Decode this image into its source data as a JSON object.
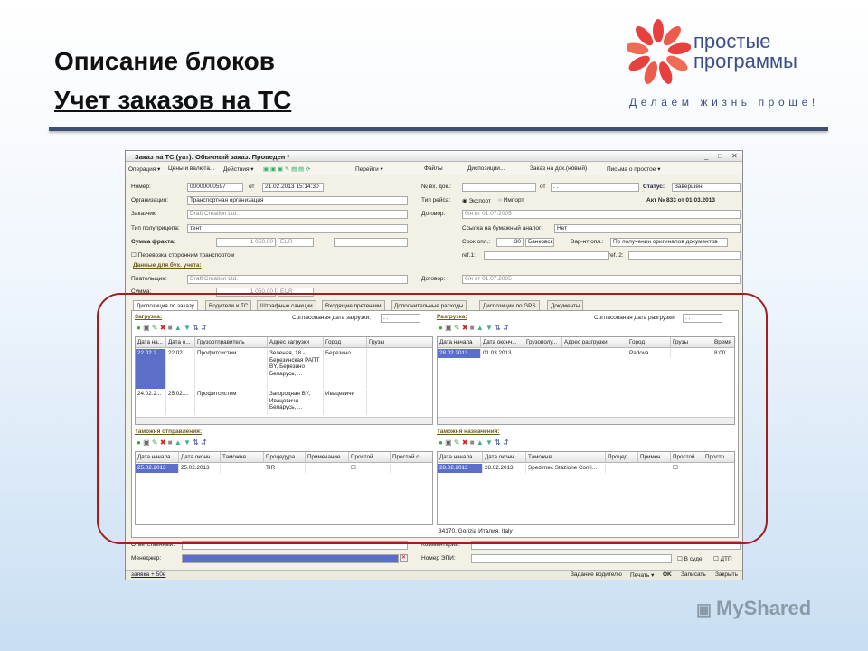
{
  "slide": {
    "title": "Описание блоков",
    "subtitle": "Учет заказов на ТС",
    "logo_name_1": "простые",
    "logo_name_2": "программы",
    "logo_slogan": "Делаем жизнь проще!",
    "watermark": "MyShared",
    "colors": {
      "accent": "#3d4f8a",
      "oval": "#a02020",
      "selection": "#5b6fc9"
    }
  },
  "window": {
    "title": "Заказ на ТС (уат): Обычный заказ. Проведен *",
    "toolbar": [
      "Операция ▾",
      "Цены и валюта...",
      "Действия ▾",
      "Перейти ▾",
      "Файлы",
      "Диспозиции...",
      "Заказ на док.(новый)",
      "Письма о простое ▾"
    ],
    "form": {
      "number_label": "Номер:",
      "number": "00000000597",
      "from_label": "от",
      "date": "21.02.2013 15:14:30",
      "inc_label": "№ вх. док.:",
      "inc_from": "от",
      "inc_date": ". .",
      "status_label": "Статус:",
      "status": "Завершен",
      "org_label": "Организация:",
      "org": "Транспортная организация",
      "trip_label": "Тип рейса:",
      "export": "Экспорт",
      "import": "Импорт",
      "act": "Акт № 833 от 01.03.2013",
      "customer_label": "Заказчик:",
      "customer": "Draft Creation Ltd.",
      "contract_label": "Договор:",
      "contract": "б/н от 01.07.2005",
      "trailer_label": "Тип полуприцепа:",
      "trailer": "тент",
      "paper_label": "Ссылка на бумажный аналог:",
      "paper": "Нет",
      "freight_label": "Сумма фрахта:",
      "freight": "1 050,00",
      "currency": "EUR",
      "term_label": "Срок опл.:",
      "term": "30",
      "bank": "Банковск",
      "variant_label": "Вар-нт опл.:",
      "variant": "По получении оригиналов документов",
      "third_party": "Перевозка сторонним транспортом",
      "ref1": "ref.1:",
      "ref2": "ref. 2:",
      "acc_header": "Данные для бух. учета:",
      "payer_label": "Плательщик:",
      "payer": "Draft Creation Ltd.",
      "contract2_label": "Договор:",
      "contract2": "б/н от 01.07.2005",
      "sum_label": "Сумма:",
      "sum": "1 050,00",
      "sum_cur": "EUR"
    },
    "tabs": [
      "Диспозиция по заказу",
      "Водители и ТС",
      "Штрафные санкции",
      "Входящие претензии",
      "Дополнительные расходы",
      "Диспозиции по GPS",
      "Документы"
    ],
    "loading": {
      "label": "Загрузка:",
      "agreed_label": "Согласованая дата загрузки:",
      "agreed": ". .",
      "columns": [
        "Дата на...",
        "Дата о...",
        "Грузоотправитель",
        "Адрес загрузки",
        "Город",
        "Грузы"
      ],
      "rows": [
        [
          "22.02.2...",
          "22.02....",
          "Профитсистем",
          "Зеленая, 18 - Березинская РАПТ BY, Березино Беларусь, ...",
          "Березино",
          ""
        ],
        [
          "24.02.2...",
          "25.02....",
          "Профитсистем",
          "Загородная BY, Ивацевичи Беларусь, ...",
          "Ивацевичи",
          ""
        ]
      ]
    },
    "unloading": {
      "label": "Разгрузка:",
      "agreed_label": "Согласованая дата разгрузки:",
      "agreed": ". .",
      "columns": [
        "Дата начала",
        "Дата оконч...",
        "Грузополу...",
        "Адрес разгрузки",
        "Город",
        "Грузы",
        "Время"
      ],
      "rows": [
        [
          "28.02.2013",
          "01.03.2013",
          "",
          "",
          "Padova",
          "",
          "8:00"
        ]
      ]
    },
    "customs_dep": {
      "label": "Таможня отправления:",
      "columns": [
        "Дата начала",
        "Дата оконч...",
        "Таможня",
        "Процедура ...",
        "Примечание",
        "Простой",
        "Простой с"
      ],
      "rows": [
        [
          "25.02.2013",
          "25.02.2013",
          "",
          "TIR",
          "",
          "",
          ""
        ]
      ]
    },
    "customs_dst": {
      "label": "Таможня назначения:",
      "columns": [
        "Дата начала",
        "Дата оконч...",
        "Таможня",
        "Процед...",
        "Примеч...",
        "Простой",
        "Просто..."
      ],
      "rows": [
        [
          "28.02.2013",
          "28.02.2013",
          "Spedimec Stazione Confi...",
          "",
          "",
          "",
          ""
        ]
      ],
      "address": "34170, Gorizia Италия, Italy"
    },
    "bottom": {
      "resp_label": "Ответственный:",
      "comment_label": "Комментарий:",
      "manager_label": "Менеджер:",
      "epi_label": "Номер ЭПИ:",
      "in_court": "В суде",
      "dtp": "ДТП"
    },
    "footer": {
      "link": "заявка + 50е",
      "driver_task": "Задание водителю",
      "print": "Печать ▾",
      "ok": "OK",
      "save": "Записать",
      "close": "Закрыть"
    }
  }
}
